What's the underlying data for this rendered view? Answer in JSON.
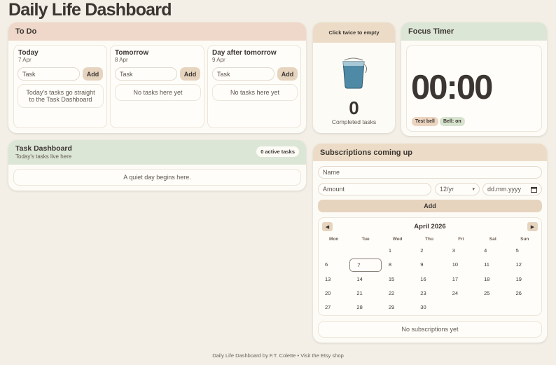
{
  "page": {
    "title": "Daily Life Dashboard"
  },
  "todo": {
    "title": "To Do",
    "columns": [
      {
        "name": "Today",
        "date": "7 Apr",
        "placeholder": "Task",
        "add": "Add",
        "empty": "Today's tasks go straight to the Task Dashboard"
      },
      {
        "name": "Tomorrow",
        "date": "8 Apr",
        "placeholder": "Task",
        "add": "Add",
        "empty": "No tasks here yet"
      },
      {
        "name": "Day after tomorrow",
        "date": "9 Apr",
        "placeholder": "Task",
        "add": "Add",
        "empty": "No tasks here yet"
      }
    ]
  },
  "jar": {
    "hint": "Click twice to empty",
    "count": "0",
    "label": "Completed tasks"
  },
  "timer": {
    "title": "Focus Timer",
    "time": "00:00",
    "test_bell": "Test bell",
    "bell_status": "Bell: on"
  },
  "task_dashboard": {
    "title": "Task Dashboard",
    "subtitle": "Today's tasks live here",
    "badge": "0 active tasks",
    "empty": "A quiet day begins here."
  },
  "subscriptions": {
    "title": "Subscriptions coming up",
    "name_placeholder": "Name",
    "amount_placeholder": "Amount",
    "period": "12/yr",
    "date_placeholder": "dd.mm.yyyy",
    "add": "Add",
    "empty": "No subscriptions yet",
    "calendar": {
      "month": "April 2026",
      "weekdays": [
        "Mon",
        "Tue",
        "Wed",
        "Thu",
        "Fri",
        "Sat",
        "Sun"
      ],
      "days": [
        "",
        "",
        "1",
        "2",
        "3",
        "4",
        "5",
        "6",
        "7",
        "8",
        "9",
        "10",
        "11",
        "12",
        "13",
        "14",
        "15",
        "16",
        "17",
        "18",
        "19",
        "20",
        "21",
        "22",
        "23",
        "24",
        "25",
        "26",
        "27",
        "28",
        "29",
        "30"
      ],
      "today": "7"
    }
  },
  "footer": {
    "text": "Daily Life Dashboard by F.T. Colette • Visit the Etsy shop"
  },
  "colors": {
    "background": "#f3efe6",
    "pink_header": "#efd8ca",
    "green_header": "#dce6d7",
    "tan_header": "#ecdcc7",
    "button": "#e6d4bf",
    "jar": "#4e8aa6"
  }
}
